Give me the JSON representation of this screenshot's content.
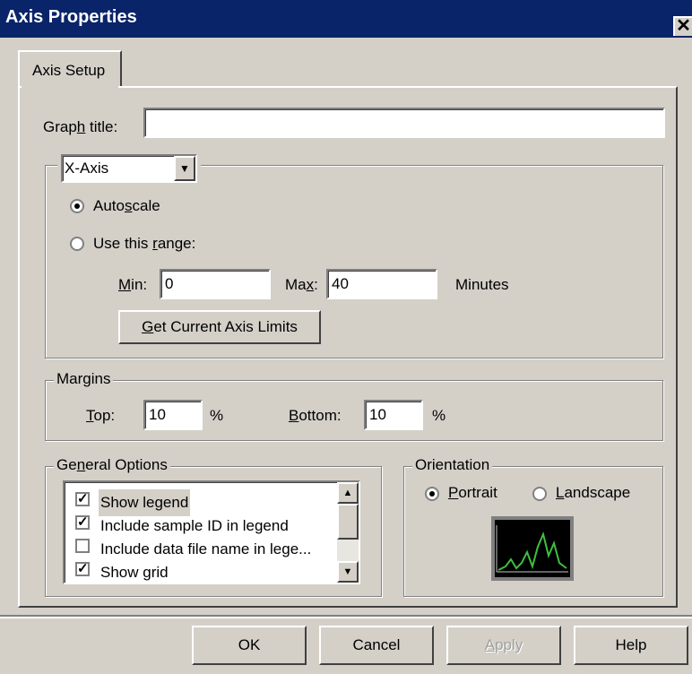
{
  "window": {
    "title": "Axis Properties",
    "close_glyph": "✕"
  },
  "tabs": [
    {
      "label": "Axis Setup"
    }
  ],
  "graph_title": {
    "label_pre": "Grap",
    "label_key": "h",
    "label_post": " title:",
    "value": ""
  },
  "axis_group": {
    "axis_select": "X-Axis",
    "autoscale": {
      "pre": "Auto",
      "key": "s",
      "post": "cale",
      "selected": true
    },
    "use_range": {
      "pre": "Use this ",
      "key": "r",
      "post": "ange:",
      "selected": false
    },
    "min_label": {
      "key": "M",
      "post": "in:"
    },
    "min_value": "0",
    "max_label": {
      "pre": "Ma",
      "key": "x",
      "post": ":"
    },
    "max_value": "40",
    "units": "Minutes",
    "get_limits": {
      "key": "G",
      "post": "et Current Axis Limits"
    }
  },
  "margins": {
    "legend": "Margins",
    "top_label": {
      "key": "T",
      "post": "op:"
    },
    "top_value": "10",
    "top_unit": "%",
    "bottom_label": {
      "key": "B",
      "post": "ottom:"
    },
    "bottom_value": "10",
    "bottom_unit": "%"
  },
  "general_options": {
    "legend": {
      "pre": "Ge",
      "key": "n",
      "post": "eral Options"
    },
    "items": [
      {
        "label": "Show legend",
        "checked": true
      },
      {
        "label": "Include sample ID in legend",
        "checked": true
      },
      {
        "label": "Include data file name in lege...",
        "checked": false
      },
      {
        "label": "Show grid",
        "checked": true
      }
    ]
  },
  "orientation": {
    "legend": "Orientation",
    "portrait": {
      "key": "P",
      "post": "ortrait",
      "selected": true
    },
    "landscape": {
      "key": "L",
      "post": "andscape",
      "selected": false
    }
  },
  "buttons": {
    "ok": "OK",
    "cancel": "Cancel",
    "apply": {
      "key": "A",
      "post": "pply",
      "enabled": false
    },
    "help": "Help"
  },
  "colors": {
    "title_bar": "#0a246a",
    "dialog_face": "#d4d0c8",
    "preview_trace": "#3fbf3f"
  }
}
